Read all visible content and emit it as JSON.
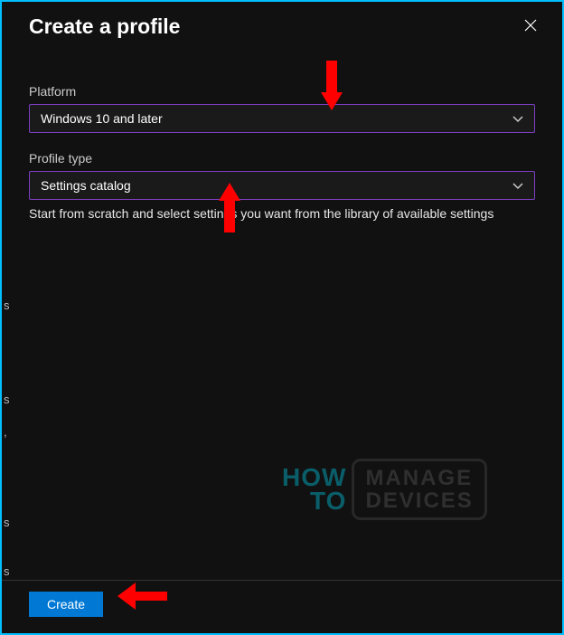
{
  "header": {
    "title": "Create a profile"
  },
  "fields": {
    "platform": {
      "label": "Platform",
      "value": "Windows 10 and later"
    },
    "profileType": {
      "label": "Profile type",
      "value": "Settings catalog",
      "description": "Start from scratch and select settings you want from the library of available settings"
    }
  },
  "footer": {
    "createLabel": "Create"
  },
  "watermark": {
    "how": "HOW",
    "to": "TO",
    "manage": "MANAGE",
    "devices": "DEVICES"
  }
}
